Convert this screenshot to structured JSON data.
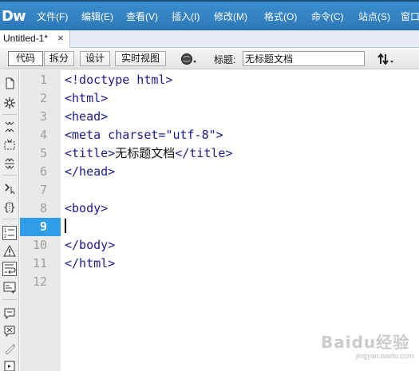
{
  "app": {
    "logo": "Dw",
    "menu": [
      "文件(F)",
      "编辑(E)",
      "查看(V)",
      "插入(I)",
      "修改(M)",
      "格式(O)",
      "命令(C)",
      "站点(S)",
      "窗口"
    ]
  },
  "document": {
    "tab_name": "Untitled-1*",
    "tab_close": "×"
  },
  "toolbar": {
    "views": [
      "代码",
      "拆分",
      "设计",
      "实时视图"
    ],
    "active_view": "代码",
    "title_label": "标题:",
    "title_value": "无标题文档"
  },
  "coding_toolbar": {
    "icons": [
      "open-documents-icon",
      "show-code-navigator-icon",
      "collapse-full-tag-icon",
      "collapse-selection-icon",
      "expand-all-icon",
      "select-parent-tag-icon",
      "balance-braces-icon",
      "line-numbers-icon",
      "highlight-invalid-code-icon",
      "word-wrap-icon",
      "syntax-coloring-icon",
      "apply-comment-icon",
      "remove-comment-icon",
      "wrap-tag-icon",
      "recent-snippets-icon"
    ]
  },
  "editor": {
    "active_line": 9,
    "line_numbers": [
      "1",
      "2",
      "3",
      "4",
      "5",
      "6",
      "7",
      "8",
      "9",
      "10",
      "11",
      "12"
    ],
    "lines": [
      "<!doctype html>",
      "<html>",
      "<head>",
      "<meta charset=\"utf-8\">",
      "<title>",
      "</head>",
      "",
      "<body>",
      "",
      "</body>",
      "</html>",
      ""
    ],
    "title_text": "无标题文档",
    "title_close": "</title>"
  },
  "watermark": {
    "brand": "Baidu经验",
    "sub": "jingyan.baidu.com"
  },
  "colors": {
    "menubar": "#3384c4",
    "tag_text": "#1b1b8c",
    "active_line_number_bg": "#2f9de8",
    "gutter": "#e9e9e9"
  }
}
